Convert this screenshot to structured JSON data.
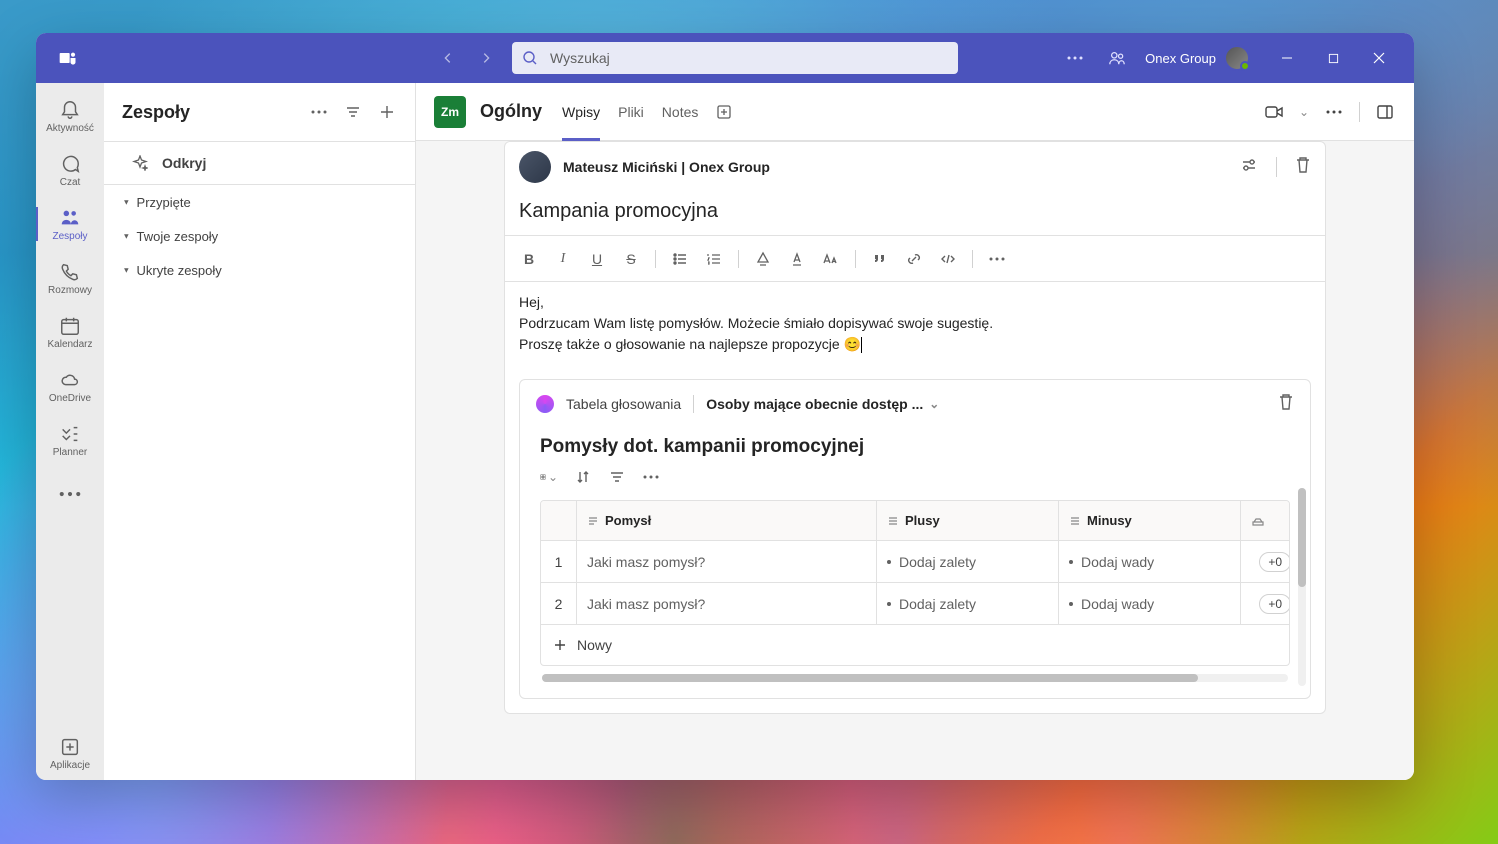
{
  "titlebar": {
    "search_placeholder": "Wyszukaj",
    "tenant_name": "Onex Group"
  },
  "rail": {
    "items": [
      {
        "label": "Aktywność"
      },
      {
        "label": "Czat"
      },
      {
        "label": "Zespoły"
      },
      {
        "label": "Rozmowy"
      },
      {
        "label": "Kalendarz"
      },
      {
        "label": "OneDrive"
      },
      {
        "label": "Planner"
      }
    ],
    "apps_label": "Aplikacje"
  },
  "left_panel": {
    "title": "Zespoły",
    "discover": "Odkryj",
    "sections": [
      "Przypięte",
      "Twoje zespoły",
      "Ukryte zespoły"
    ]
  },
  "channel": {
    "team_initials": "Zm",
    "name": "Ogólny",
    "tabs": [
      "Wpisy",
      "Pliki",
      "Notes"
    ]
  },
  "compose": {
    "author": "Mateusz Miciński | Onex Group",
    "subject": "Kampania promocyjna",
    "body_line1": "Hej,",
    "body_line2": "Podrzucam Wam listę pomysłów. Możecie śmiało dopisywać swoje sugestię.",
    "body_line3": "Proszę także o głosowanie na najlepsze propozycje 😊"
  },
  "loop": {
    "component_name": "Tabela głosowania",
    "access_label": "Osoby mające obecnie dostęp ...",
    "title": "Pomysły dot. kampanii promocyjnej",
    "columns": [
      "Pomysł",
      "Plusy",
      "Minusy"
    ],
    "rows": [
      {
        "idx": "1",
        "idea": "Jaki masz pomysł?",
        "plus": "Dodaj zalety",
        "minus": "Dodaj wady",
        "vote": "+0"
      },
      {
        "idx": "2",
        "idea": "Jaki masz pomysł?",
        "plus": "Dodaj zalety",
        "minus": "Dodaj wady",
        "vote": "+0"
      }
    ],
    "add_row": "Nowy"
  }
}
